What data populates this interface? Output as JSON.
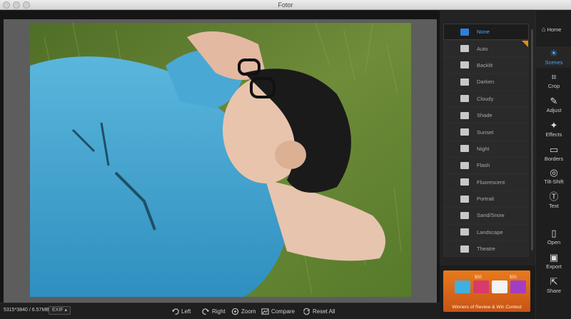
{
  "window": {
    "title": "Fotor"
  },
  "toolbar": {
    "dimensions": "5315*3840 / 6.57MB",
    "exif_label": "EXIF",
    "rotate_left": "Left",
    "rotate_right": "Right",
    "zoom": "Zoom",
    "compare": "Compare",
    "reset_all": "Reset All"
  },
  "scenes": {
    "items": [
      {
        "label": "None",
        "icon": "none-icon",
        "active": true
      },
      {
        "label": "Auto",
        "icon": "camera-icon"
      },
      {
        "label": "Backlit",
        "icon": "backlit-icon"
      },
      {
        "label": "Darken",
        "icon": "darken-icon"
      },
      {
        "label": "Cloudy",
        "icon": "cloud-icon"
      },
      {
        "label": "Shade",
        "icon": "shade-icon"
      },
      {
        "label": "Sunset",
        "icon": "sunset-icon"
      },
      {
        "label": "Night",
        "icon": "moon-icon"
      },
      {
        "label": "Flash",
        "icon": "flash-icon"
      },
      {
        "label": "Fluorescent",
        "icon": "bulb-icon"
      },
      {
        "label": "Portrait",
        "icon": "portrait-icon"
      },
      {
        "label": "Sand/Snow",
        "icon": "sand-snow-icon"
      },
      {
        "label": "Landscape",
        "icon": "landscape-icon"
      },
      {
        "label": "Theatre",
        "icon": "theatre-icon"
      }
    ]
  },
  "ad": {
    "text": "Winners of Review & Win Contest",
    "price_a": "$50",
    "price_b": "$50"
  },
  "rail": {
    "home": "Home",
    "scenes": "Scenes",
    "crop": "Crop",
    "adjust": "Adjust",
    "effects": "Effects",
    "borders": "Borders",
    "tilt_shift": "Tilt-Shift",
    "text": "Text",
    "open": "Open",
    "export": "Export",
    "share": "Share"
  },
  "colors": {
    "accent": "#4aa3ff",
    "active_icon": "#2f7fd8",
    "badge": "#e88a1a"
  }
}
